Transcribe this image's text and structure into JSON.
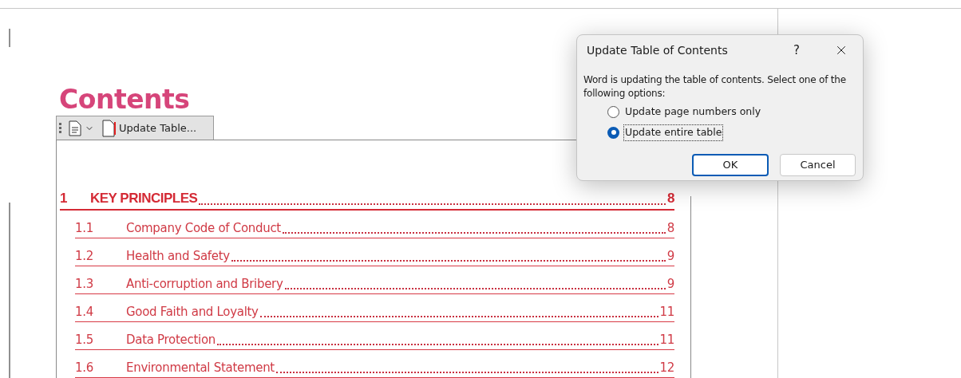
{
  "document": {
    "heading": "Contents",
    "toc_toolbar": {
      "button": "Update Table..."
    },
    "toc": [
      {
        "number": "1",
        "title": "KEY PRINCIPLES",
        "page": "8",
        "kind": "chapter"
      },
      {
        "number": "1.1",
        "title": "Company Code of Conduct",
        "page": "8",
        "kind": "section"
      },
      {
        "number": "1.2",
        "title": "Health and Safety",
        "page": "9",
        "kind": "section"
      },
      {
        "number": "1.3",
        "title": "Anti-corruption and Bribery",
        "page": "9",
        "kind": "section"
      },
      {
        "number": "1.4",
        "title": "Good Faith and Loyalty",
        "page": "11",
        "kind": "section"
      },
      {
        "number": "1.5",
        "title": "Data Protection",
        "page": "11",
        "kind": "section"
      },
      {
        "number": "1.6",
        "title": "Environmental Statement",
        "page": "12",
        "kind": "section"
      }
    ]
  },
  "dialog": {
    "title": "Update Table of Contents",
    "help": "?",
    "message": "Word is updating the table of contents.  Select one of the following options:",
    "options": [
      {
        "label": "Update page numbers only",
        "selected": false
      },
      {
        "label": "Update entire table",
        "selected": true
      }
    ],
    "buttons": [
      {
        "label": "OK",
        "kind": "default"
      },
      {
        "label": "Cancel",
        "kind": "normal"
      }
    ]
  }
}
